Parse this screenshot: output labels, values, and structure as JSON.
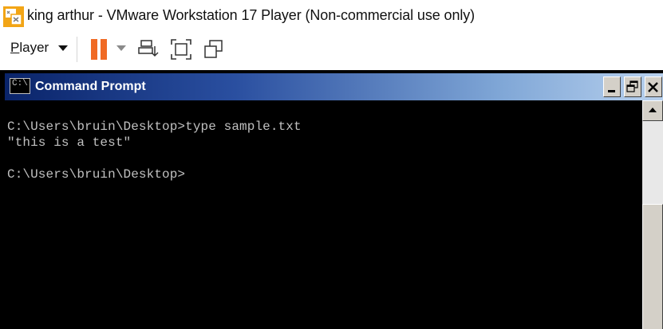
{
  "vmware": {
    "title": "king arthur - VMware Workstation 17 Player (Non-commercial use only)",
    "toolbar": {
      "player_label_first": "P",
      "player_label_rest": "layer",
      "icons": [
        "pause-icon",
        "send-ctrl-alt-del-icon",
        "full-screen-icon",
        "unity-icon"
      ],
      "accent_color": "#f06a24"
    }
  },
  "cmd": {
    "title": "Command Prompt",
    "lines": [
      "C:\\Users\\bruin\\Desktop>type sample.txt",
      "\"this is a test\"",
      "C:\\Users\\bruin\\Desktop>"
    ],
    "icon_text": "C:\\"
  }
}
